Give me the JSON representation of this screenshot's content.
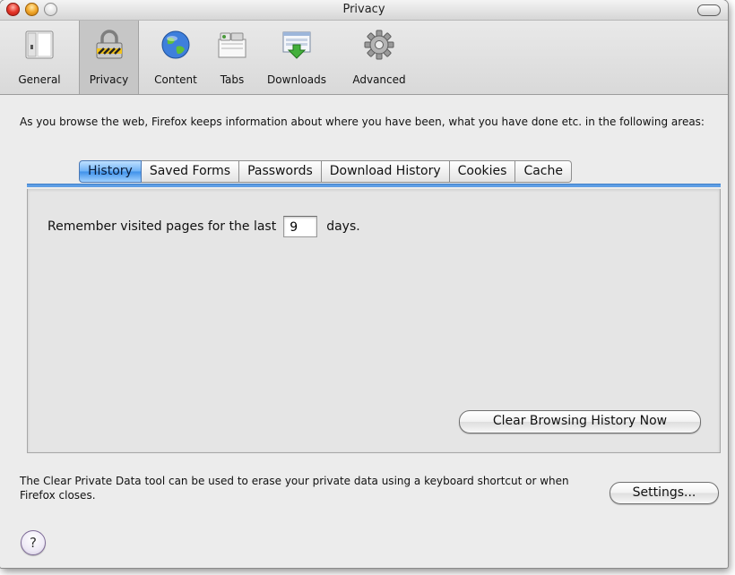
{
  "window": {
    "title": "Privacy",
    "accent_color": "#5e9ee4"
  },
  "toolbar": {
    "items": [
      {
        "label": "General",
        "icon": "general-panel-icon",
        "selected": false
      },
      {
        "label": "Privacy",
        "icon": "padlock-icon",
        "selected": true
      },
      {
        "label": "Content",
        "icon": "globe-icon",
        "selected": false
      },
      {
        "label": "Tabs",
        "icon": "tabs-icon",
        "selected": false
      },
      {
        "label": "Downloads",
        "icon": "download-icon",
        "selected": false
      },
      {
        "label": "Advanced",
        "icon": "gear-icon",
        "selected": false
      }
    ]
  },
  "intro_text": "As you browse the web, Firefox keeps information about where you have been, what you have done etc. in the following areas:",
  "tabs": [
    {
      "label": "History",
      "selected": true
    },
    {
      "label": "Saved Forms",
      "selected": false
    },
    {
      "label": "Passwords",
      "selected": false
    },
    {
      "label": "Download History",
      "selected": false
    },
    {
      "label": "Cookies",
      "selected": false
    },
    {
      "label": "Cache",
      "selected": false
    }
  ],
  "history": {
    "label_before": "Remember visited pages for the last",
    "days_value": "9",
    "label_after": "days.",
    "clear_button": "Clear Browsing History Now"
  },
  "footer": {
    "text": "The Clear Private Data tool can be used to erase your private data using a keyboard shortcut or when Firefox closes.",
    "settings_button": "Settings...",
    "help_button": "?"
  }
}
